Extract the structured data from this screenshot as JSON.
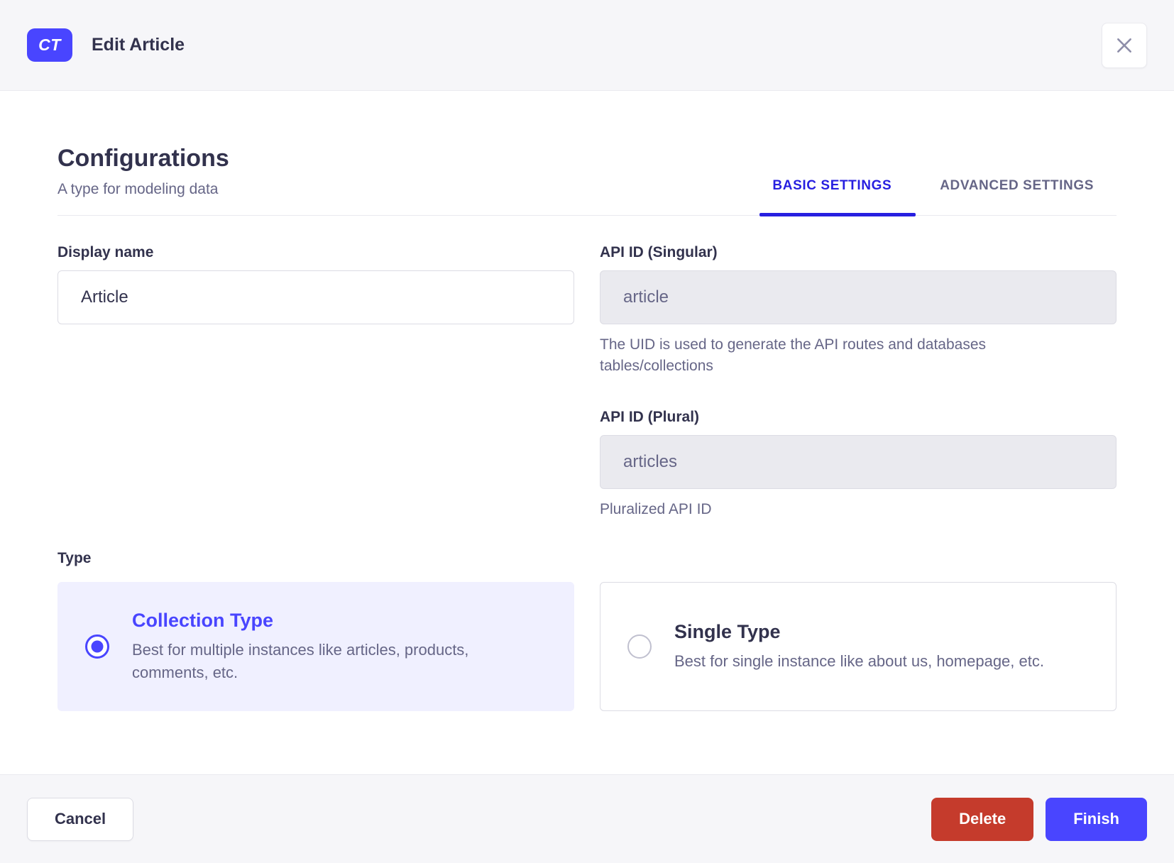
{
  "modal": {
    "header": {
      "badge": "CT",
      "title": "Edit Article",
      "close_icon": "x-mark"
    },
    "section": {
      "title": "Configurations",
      "subtitle": "A type for modeling data"
    },
    "tabs": [
      {
        "label": "BASIC SETTINGS",
        "active": true
      },
      {
        "label": "ADVANCED SETTINGS",
        "active": false
      }
    ],
    "fields": {
      "display_name": {
        "label": "Display name",
        "value": "Article"
      },
      "api_id_singular": {
        "label": "API ID (Singular)",
        "value": "article",
        "hint": "The UID is used to generate the API routes and databases tables/collections"
      },
      "api_id_plural": {
        "label": "API ID (Plural)",
        "value": "articles",
        "hint": "Pluralized API ID"
      }
    },
    "type": {
      "label": "Type",
      "options": [
        {
          "title": "Collection Type",
          "description": "Best for multiple instances like articles, products, comments, etc.",
          "selected": true
        },
        {
          "title": "Single Type",
          "description": "Best for single instance like about us, homepage, etc.",
          "selected": false
        }
      ]
    },
    "footer": {
      "cancel": "Cancel",
      "delete": "Delete",
      "finish": "Finish"
    },
    "colors": {
      "primary": "#4945ff",
      "tab_active": "#271fe0",
      "danger": "#c53b2c",
      "selected_card_bg": "#f0f0ff",
      "surface_muted": "#f6f6f9"
    }
  }
}
